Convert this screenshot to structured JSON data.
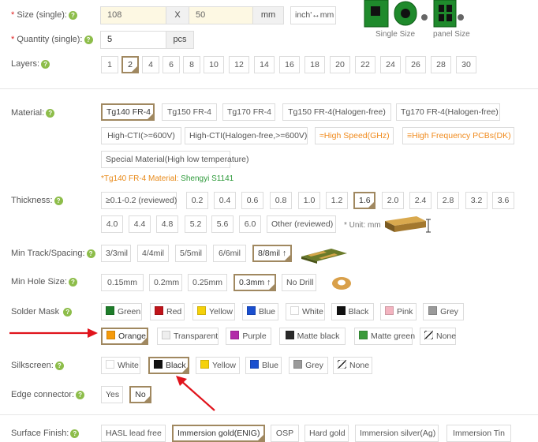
{
  "size": {
    "label": "Size (single):",
    "width_value": "108",
    "times": "X",
    "height_value": "50",
    "unit": "mm",
    "convert_button": "inch'↔mm",
    "single_caption": "Single Size",
    "panel_caption": "panel Size"
  },
  "quantity": {
    "label": "Quantity (single):",
    "value": "5",
    "unit": "pcs"
  },
  "layers": {
    "label": "Layers:",
    "options": [
      "1",
      "2",
      "4",
      "6",
      "8",
      "10",
      "12",
      "14",
      "16",
      "18",
      "20",
      "22",
      "24",
      "26",
      "28",
      "30"
    ],
    "selected": "2"
  },
  "material": {
    "label": "Material:",
    "options": [
      "Tg140 FR-4",
      "Tg150 FR-4",
      "Tg170 FR-4",
      "Tg150 FR-4(Halogen-free)",
      "Tg170 FR-4(Halogen-free)",
      "High-CTI(>=600V)",
      "High-CTI(Halogen-free,>=600V)",
      "≈High Speed(GHz)",
      "≡High Frequency PCBs(DK)",
      "Special Material(High low temperature)"
    ],
    "selected": "Tg140 FR-4",
    "note_prefix": "*Tg140 FR-4 Material: ",
    "note_value": "Shengyi S1141"
  },
  "thickness": {
    "label": "Thickness:",
    "options": [
      "≥0.1-0.2 (reviewed)",
      "0.2",
      "0.4",
      "0.6",
      "0.8",
      "1.0",
      "1.2",
      "1.6",
      "2.0",
      "2.4",
      "2.8",
      "3.2",
      "3.6",
      "4.0",
      "4.4",
      "4.8",
      "5.2",
      "5.6",
      "6.0",
      "Other (reviewed)"
    ],
    "selected": "1.6",
    "unit_note": "* Unit: mm"
  },
  "track": {
    "label": "Min Track/Spacing:",
    "options": [
      "3/3mil",
      "4/4mil",
      "5/5mil",
      "6/6mil",
      "8/8mil ↑"
    ],
    "selected": "8/8mil ↑"
  },
  "hole": {
    "label": "Min Hole Size:",
    "options": [
      "0.15mm",
      "0.2mm",
      "0.25mm",
      "0.3mm ↑",
      "No Drill"
    ],
    "selected": "0.3mm ↑"
  },
  "solder": {
    "label": "Solder Mask",
    "options": [
      {
        "name": "Green",
        "color": "#1e7d2a"
      },
      {
        "name": "Red",
        "color": "#c0141a"
      },
      {
        "name": "Yellow",
        "color": "#f5d10a"
      },
      {
        "name": "Blue",
        "color": "#1a4fcf"
      },
      {
        "name": "White",
        "color": "#ffffff"
      },
      {
        "name": "Black",
        "color": "#111111"
      },
      {
        "name": "Pink",
        "color": "#f3b4c0"
      },
      {
        "name": "Grey",
        "color": "#9a9a9a"
      },
      {
        "name": "Orange",
        "color": "#f59a0a"
      },
      {
        "name": "Transparent",
        "color": "#eeeeee"
      },
      {
        "name": "Purple",
        "color": "#b22aa8"
      },
      {
        "name": "Matte black",
        "color": "#2a2a2a"
      },
      {
        "name": "Matte green",
        "color": "#3a9a3a"
      },
      {
        "name": "None",
        "color": "none"
      }
    ],
    "selected": "Orange"
  },
  "silkscreen": {
    "label": "Silkscreen:",
    "options": [
      {
        "name": "White",
        "color": "#ffffff"
      },
      {
        "name": "Black",
        "color": "#111111"
      },
      {
        "name": "Yellow",
        "color": "#f5d10a"
      },
      {
        "name": "Blue",
        "color": "#1a4fcf"
      },
      {
        "name": "Grey",
        "color": "#9a9a9a"
      },
      {
        "name": "None",
        "color": "none"
      }
    ],
    "selected": "Black"
  },
  "edge": {
    "label": "Edge connector:",
    "options": [
      "Yes",
      "No"
    ],
    "selected": "No"
  },
  "finish": {
    "label": "Surface Finish:",
    "options": [
      "HASL lead free",
      "Immersion gold(ENIG)",
      "OSP",
      "Hard gold",
      "Immersion silver(Ag)",
      "Immersion Tin"
    ],
    "selected": "Immersion gold(ENIG)"
  },
  "colors": {
    "accent_border": "#a08860",
    "arrow": "#e0141c",
    "help_icon": "#8dbd4a"
  }
}
